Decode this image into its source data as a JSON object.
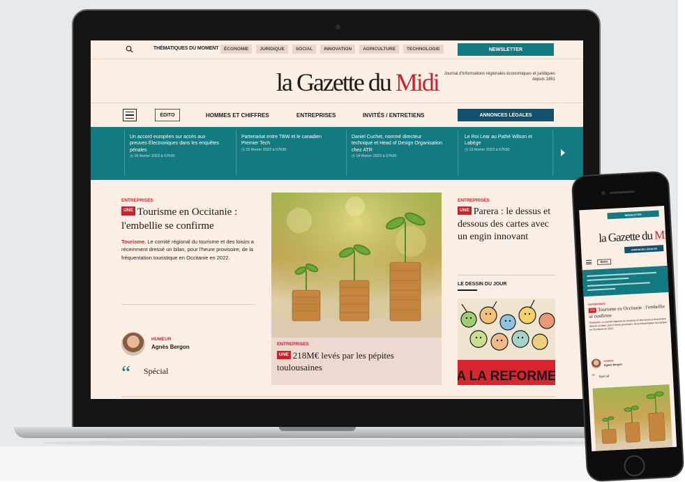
{
  "site": {
    "logo_main": "la Gazette du ",
    "logo_accent": "Midi",
    "tagline": "Journal d'informations régionales économiques et juridiques depuis 1861",
    "accent_color": "#147a82",
    "brand_red": "#c8232c"
  },
  "topbar": {
    "topics_label": "THÉMATIQUES DU MOMENT",
    "tags": [
      "ÉCONOMIE",
      "JURIDIQUE",
      "SOCIAL",
      "INNOVATION",
      "AGRICULTURE",
      "TECHNOLOGIE"
    ],
    "newsletter_label": "NEWSLETTER"
  },
  "nav": {
    "edito_label": "ÉDITO",
    "items": [
      "HOMMES ET CHIFFRES",
      "ENTREPRISES",
      "INVITÉS / ENTRETIENS"
    ],
    "annonces_label": "ANNONCES LÉGALES"
  },
  "ticker": [
    {
      "title": "Un accord européen sur accès aux preuves Électroniques dans les enquêtes pénales",
      "date": "16 février 2023 à 07h30"
    },
    {
      "title": "Partenariat entre TBW et le canadien Premier Tech",
      "date": "15 février 2023 à 07h30"
    },
    {
      "title": "Daniel Cuchet, nommé directeur technique et Head of Design Organisation chez ATR",
      "date": "14 février 2023 à 07h30"
    },
    {
      "title": "Le Roi Lear au Pathé Wilson et Labège",
      "date": "13 février 2023 à 07h30"
    }
  ],
  "main": {
    "une_badge": "UNE",
    "article1": {
      "section": "ENTREPRISES",
      "headline": "Tourisme en Occitanie : l'embellie se confirme",
      "summary_lead": "Tourisme",
      "summary_rest": ". Le comité régional du tourisme et des loisirs a récemment dressé un bilan, pour l'heure provisoire, de la fréquentation touristique en Occitanie en 2022."
    },
    "humeur": {
      "label": "HUMEUR",
      "author": "Agnès Bergon",
      "quote": "Spécial"
    },
    "feature": {
      "section": "ENTREPRISES",
      "headline": "218M€ levés par les pépites toulousaines"
    },
    "article3": {
      "section": "ENTREPRISES",
      "headline": "Parera : le dessus et dessous des cartes avec un engin innovant"
    },
    "dessin_label": "LE DESSIN DU JOUR",
    "cartoon_banner": "A LA REFORME"
  },
  "phone": {
    "newsletter_label": "NEWSLETTER",
    "annonces_label": "ANNONCES LÉGALES",
    "edito_label": "ÉDITO",
    "section": "ENTREPRISES",
    "une_badge": "UNE",
    "headline": "Tourisme en Occitanie : l'embellie se confirme",
    "summary_lead": "Tourisme",
    "summary_rest": ". Le comité régional du tourisme et des loisirs a récemment dressé un bilan, pour l'heure provisoire, de la fréquentation touristique en Occitanie en 2022.",
    "humeur_label": "HUMEUR",
    "author": "Agnès Bergon",
    "quote": "Spécial"
  }
}
